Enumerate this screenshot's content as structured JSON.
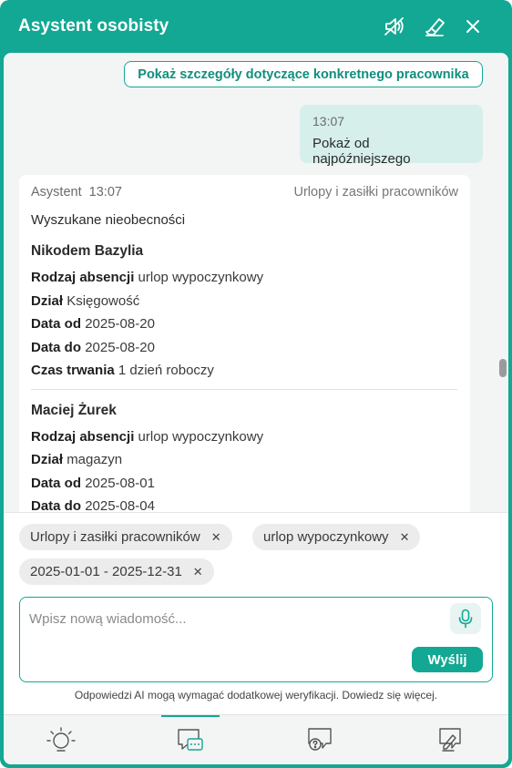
{
  "header": {
    "title": "Asystent osobisty",
    "icons": [
      "mute-icon",
      "eraser-icon",
      "close-icon"
    ]
  },
  "chat": {
    "suggestion_label": "Pokaż szczegóły dotyczące konkretnego pracownika",
    "user_message": {
      "time": "13:07",
      "text": "Pokaż od najpóźniejszego"
    },
    "bot_message": {
      "sender": "Asystent",
      "time": "13:07",
      "context": "Urlopy i zasiłki pracowników",
      "intro": "Wyszukane nieobecności",
      "labels": {
        "type": "Rodzaj absencji",
        "department": "Dział",
        "date_from": "Data od",
        "date_to": "Data do",
        "duration": "Czas trwania"
      },
      "entries": [
        {
          "name": "Nikodem Bazylia",
          "type": "urlop wypoczynkowy",
          "department": "Księgowość",
          "date_from": "2025-08-20",
          "date_to": "2025-08-20",
          "duration": "1 dzień roboczy"
        },
        {
          "name": "Maciej Żurek",
          "type": "urlop wypoczynkowy",
          "department": "magazyn",
          "date_from": "2025-08-01",
          "date_to": "2025-08-04"
        }
      ]
    }
  },
  "filters": {
    "chips": [
      "Urlopy i zasiłki pracowników",
      "urlop wypoczynkowy",
      "2025-01-01 - 2025-12-31"
    ]
  },
  "composer": {
    "placeholder": "Wpisz nową wiadomość...",
    "send_label": "Wyślij",
    "disclaimer": "Odpowiedzi AI mogą wymagać dodatkowej weryfikacji. Dowiedz się więcej."
  },
  "nav": {
    "items": [
      "lightbulb-icon",
      "chat-icon",
      "help-icon",
      "edit-icon"
    ],
    "active_index": 1
  },
  "colors": {
    "accent": "#12a893",
    "user_bubble": "#d6efea",
    "panel_bg": "#f3f4f4"
  }
}
